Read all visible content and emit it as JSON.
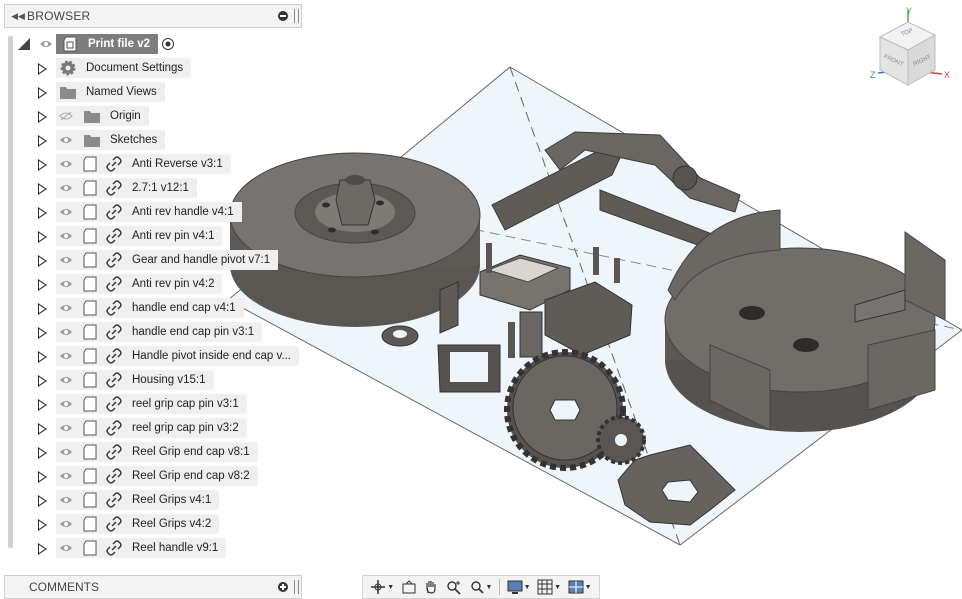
{
  "browser": {
    "title": "BROWSER",
    "root": {
      "label": "Print file v2"
    },
    "items": [
      {
        "label": "Document Settings",
        "kind": "gear-icon"
      },
      {
        "label": "Named Views",
        "kind": "folder-icon"
      },
      {
        "label": "Origin",
        "kind": "folder-icon",
        "hidden": true
      },
      {
        "label": "Sketches",
        "kind": "folder-icon"
      },
      {
        "label": "Anti Reverse v3:1",
        "kind": "component"
      },
      {
        "label": "2.7:1 v12:1",
        "kind": "component"
      },
      {
        "label": "Anti rev handle v4:1",
        "kind": "component"
      },
      {
        "label": "Anti rev pin v4:1",
        "kind": "component"
      },
      {
        "label": "Gear and handle pivot v7:1",
        "kind": "component"
      },
      {
        "label": "Anti rev pin v4:2",
        "kind": "component"
      },
      {
        "label": "handle end cap v4:1",
        "kind": "component"
      },
      {
        "label": "handle end cap pin v3:1",
        "kind": "component"
      },
      {
        "label": "Handle pivot inside end cap v...",
        "kind": "component"
      },
      {
        "label": "Housing v15:1",
        "kind": "component"
      },
      {
        "label": "reel grip cap pin v3:1",
        "kind": "component"
      },
      {
        "label": "reel grip cap pin v3:2",
        "kind": "component"
      },
      {
        "label": "Reel Grip end cap v8:1",
        "kind": "component"
      },
      {
        "label": "Reel Grip end cap v8:2",
        "kind": "component"
      },
      {
        "label": "Reel Grips v4:1",
        "kind": "component"
      },
      {
        "label": "Reel Grips v4:2",
        "kind": "component"
      },
      {
        "label": "Reel handle v9:1",
        "kind": "component"
      }
    ]
  },
  "comments": {
    "title": "COMMENTS"
  },
  "viewcube": {
    "top": "TOP",
    "front": "FRONT",
    "right": "RIGHT",
    "x": "X",
    "y": "Y",
    "z": "Z"
  },
  "toolbar": {
    "items": [
      "orbit-icon",
      "look-at-icon",
      "pan-icon",
      "zoom-icon",
      "fit-icon",
      "display-settings-icon",
      "grid-icon",
      "viewports-icon"
    ]
  },
  "colors": {
    "panel_bg": "#efefef",
    "active_file": "#7d7d7d",
    "part_fill": "#6e6a66",
    "part_dark": "#4f4c49",
    "ground": "#e8f1f8"
  }
}
